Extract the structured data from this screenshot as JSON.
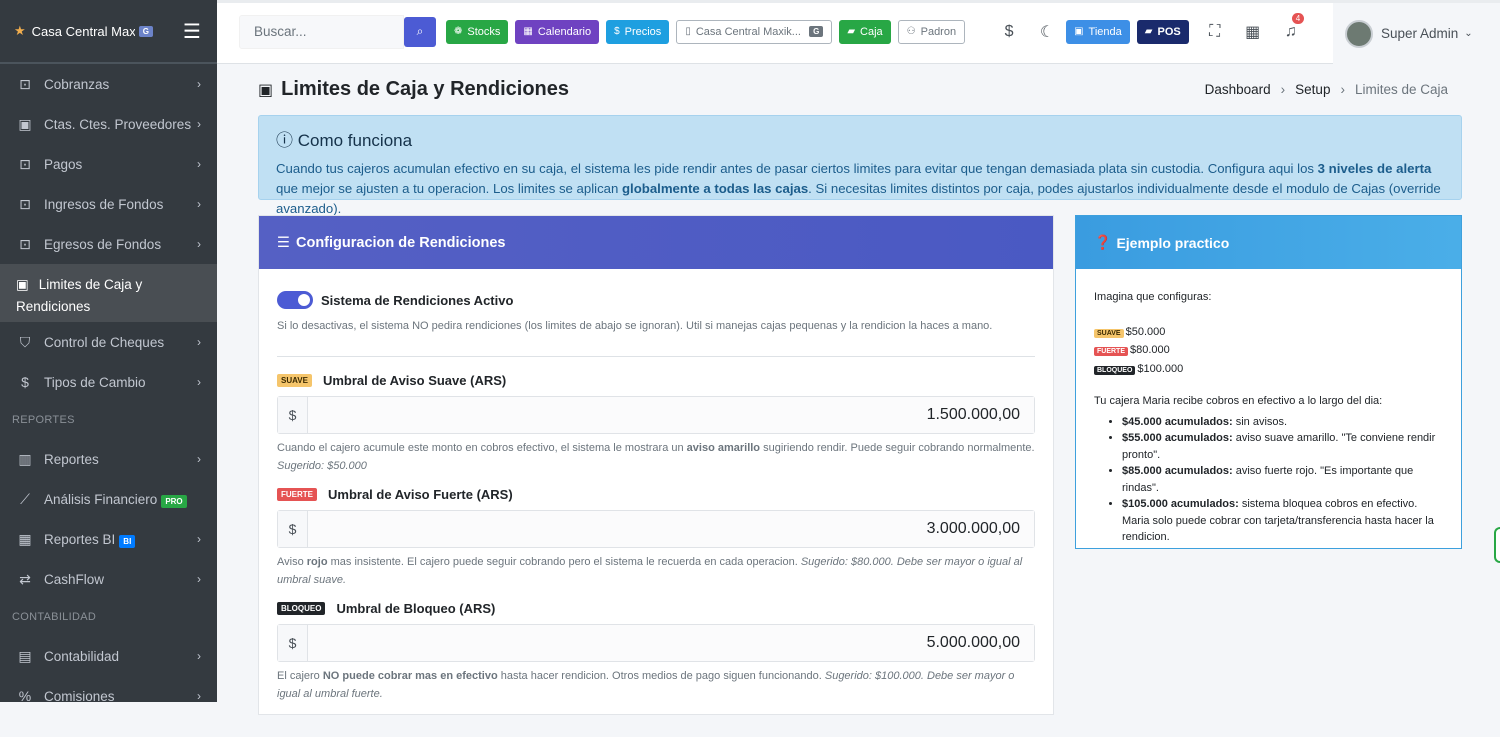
{
  "brand": {
    "name": "Casa Central Max...",
    "badge": "G"
  },
  "sidebar": {
    "items": [
      {
        "label": "Cobranzas"
      },
      {
        "label": "Ctas. Ctes. Proveedores"
      },
      {
        "label": "Pagos"
      },
      {
        "label": "Ingresos de Fondos"
      },
      {
        "label": "Egresos de Fondos"
      },
      {
        "label": "Limites de Caja y Rendiciones"
      },
      {
        "label": "Control de Cheques"
      },
      {
        "label": "Tipos de Cambio"
      }
    ],
    "header_reportes": "REPORTES",
    "reportes": [
      {
        "label": "Reportes"
      },
      {
        "label": "Análisis Financiero",
        "badge": "PRO"
      },
      {
        "label": "Reportes BI",
        "badge": "BI"
      },
      {
        "label": "CashFlow"
      }
    ],
    "header_contabilidad": "CONTABILIDAD",
    "contabilidad": [
      {
        "label": "Contabilidad"
      },
      {
        "label": "Comisiones"
      }
    ]
  },
  "topbar": {
    "search_placeholder": "Buscar...",
    "stocks": "Stocks",
    "calendario": "Calendario",
    "precios": "Precios",
    "casa": "Casa Central Maxik...",
    "casa_badge": "G",
    "caja": "Caja",
    "padron": "Padron",
    "tienda": "Tienda",
    "pos": "POS",
    "notif_count": "4",
    "user": "Super Admin"
  },
  "page": {
    "title": "Limites de Caja y Rendiciones",
    "breadcrumb": [
      "Dashboard",
      "Setup",
      "Limites de Caja"
    ]
  },
  "info": {
    "title": "Como funciona",
    "text1": "Cuando tus cajeros acumulan efectivo en su caja, el sistema les pide rendir antes de pasar ciertos limites para evitar que tengan demasiada plata sin custodia. Configura aqui los ",
    "bold1": "3 niveles de alerta",
    "text2": " que mejor se ajusten a tu operacion. Los limites se aplican ",
    "bold2": "globalmente a todas las cajas",
    "text3": ". Si necesitas limites distintos por caja, podes ajustarlos individualmente desde el modulo de Cajas (override avanzado)."
  },
  "config": {
    "title": "Configuracion de Rendiciones",
    "toggle_label": "Sistema de Rendiciones Activo",
    "toggle_help": "Si lo desactivas, el sistema NO pedira rendiciones (los limites de abajo se ignoran). Util si manejas cajas pequenas y la rendicion la haces a mano.",
    "currency": "$",
    "suave": {
      "tag": "SUAVE",
      "title": "Umbral de Aviso Suave (ARS)",
      "value": "1.500.000,00",
      "help_a": "Cuando el cajero acumule este monto en cobros efectivo, el sistema le mostrara un ",
      "help_b": "aviso amarillo",
      "help_c": " sugiriendo rendir. Puede seguir cobrando normalmente.",
      "help_sug": "Sugerido: $50.000"
    },
    "fuerte": {
      "tag": "FUERTE",
      "title": "Umbral de Aviso Fuerte (ARS)",
      "value": "3.000.000,00",
      "help_a": "Aviso ",
      "help_b": "rojo",
      "help_c": " mas insistente. El cajero puede seguir cobrando pero el sistema le recuerda en cada operacion. ",
      "help_sug": "Sugerido: $80.000. Debe ser mayor o igual al umbral suave."
    },
    "bloqueo": {
      "tag": "BLOQUEO",
      "title": "Umbral de Bloqueo (ARS)",
      "value": "5.000.000,00",
      "help_a": "El cajero ",
      "help_b": "NO puede cobrar mas en efectivo",
      "help_c": " hasta hacer rendicion. Otros medios de pago siguen funcionando. ",
      "help_sug": "Sugerido: $100.000. Debe ser mayor o igual al umbral fuerte."
    }
  },
  "example": {
    "title": "Ejemplo practico",
    "intro": "Imagina que configuras:",
    "levels": [
      {
        "tag": "SUAVE",
        "value": "$50.000"
      },
      {
        "tag": "FUERTE",
        "value": "$80.000"
      },
      {
        "tag": "BLOQUEO",
        "value": "$100.000"
      }
    ],
    "story": "Tu cajera Maria recibe cobros en efectivo a lo largo del dia:",
    "items": [
      {
        "b": "$45.000 acumulados:",
        "t": " sin avisos."
      },
      {
        "b": "$55.000 acumulados:",
        "t": " aviso suave amarillo. \"Te conviene rendir pronto\"."
      },
      {
        "b": "$85.000 acumulados:",
        "t": " aviso fuerte rojo. \"Es importante que rindas\"."
      },
      {
        "b": "$105.000 acumulados:",
        "t": " sistema bloquea cobros en efectivo. Maria solo puede cobrar con tarjeta/transferencia hasta hacer la rendicion."
      }
    ]
  }
}
